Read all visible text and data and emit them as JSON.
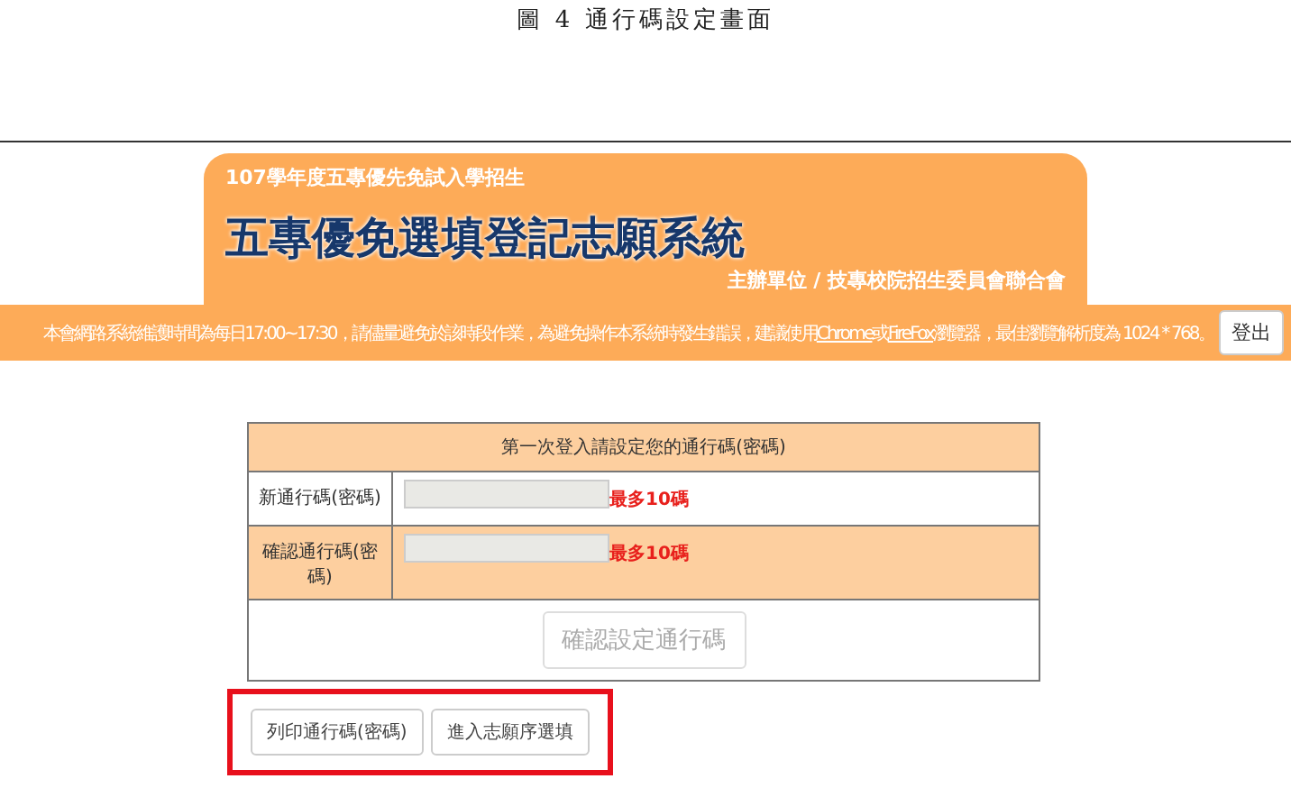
{
  "caption": "圖 4 通行碼設定畫面",
  "header": {
    "subtitle": "107學年度五專優先免試入學招生",
    "title": "五專優免選填登記志願系統",
    "organizer": "主辦單位 / 技專校院招生委員會聯合會"
  },
  "notice": {
    "parts": [
      {
        "kind": "text",
        "text": "本會網路系統維護時間為每日17:00~17:30，請儘量避免於該時段作業，為避免操作本系統時發生錯誤，建議使用"
      },
      {
        "kind": "link",
        "text": "Chrome"
      },
      {
        "kind": "text",
        "text": "或"
      },
      {
        "kind": "link",
        "text": "FireFox"
      },
      {
        "kind": "text",
        "text": "瀏覽器，最佳瀏覽解析度為 1024 * 768。"
      }
    ],
    "logout": "登出"
  },
  "form": {
    "title": "第一次登入請設定您的通行碼(密碼)",
    "rows": [
      {
        "label": "新通行碼(密碼)",
        "hint": "最多10碼"
      },
      {
        "label": "確認通行碼(密碼)",
        "hint": "最多10碼"
      }
    ],
    "submit": {
      "label": "確認設定通行碼",
      "disabled": true
    }
  },
  "actions": {
    "highlighted": true,
    "buttons": [
      "列印通行碼(密碼)",
      "進入志願序選填"
    ]
  }
}
